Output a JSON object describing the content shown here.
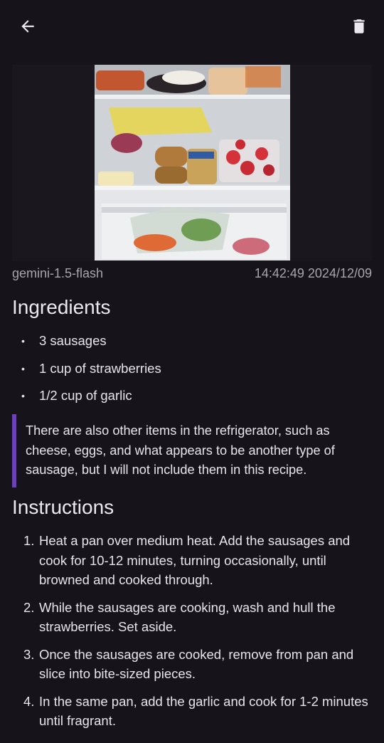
{
  "toolbar": {
    "back_icon": "arrow-left-icon",
    "delete_icon": "trash-icon"
  },
  "photo": {
    "subject": "refrigerator-interior-photo"
  },
  "meta": {
    "model": "gemini-1.5-flash",
    "timestamp": "14:42:49 2024/12/09"
  },
  "ingredients": {
    "heading": "Ingredients",
    "items": [
      "3 sausages",
      "1 cup of strawberries",
      "1/2 cup of garlic"
    ]
  },
  "note": "There are also other items in the refrigerator, such as cheese, eggs, and what appears to be another type of sausage, but I will not include them in this recipe.",
  "instructions": {
    "heading": "Instructions",
    "steps": [
      {
        "num": "1.",
        "text": "Heat a pan over medium heat. Add the sausages and cook for 10-12 minutes, turning occasionally, until browned and cooked through."
      },
      {
        "num": "2.",
        "text": "While the sausages are cooking, wash and hull the strawberries. Set aside."
      },
      {
        "num": "3.",
        "text": "Once the sausages are cooked, remove from pan and slice into bite-sized pieces."
      },
      {
        "num": "4.",
        "text": "In the same pan, add the garlic and cook for 1-2 minutes until fragrant."
      }
    ]
  },
  "colors": {
    "background": "#16131a",
    "accent": "#6b3fc0",
    "text": "#e8e4ec",
    "muted": "#a9a4ad"
  }
}
